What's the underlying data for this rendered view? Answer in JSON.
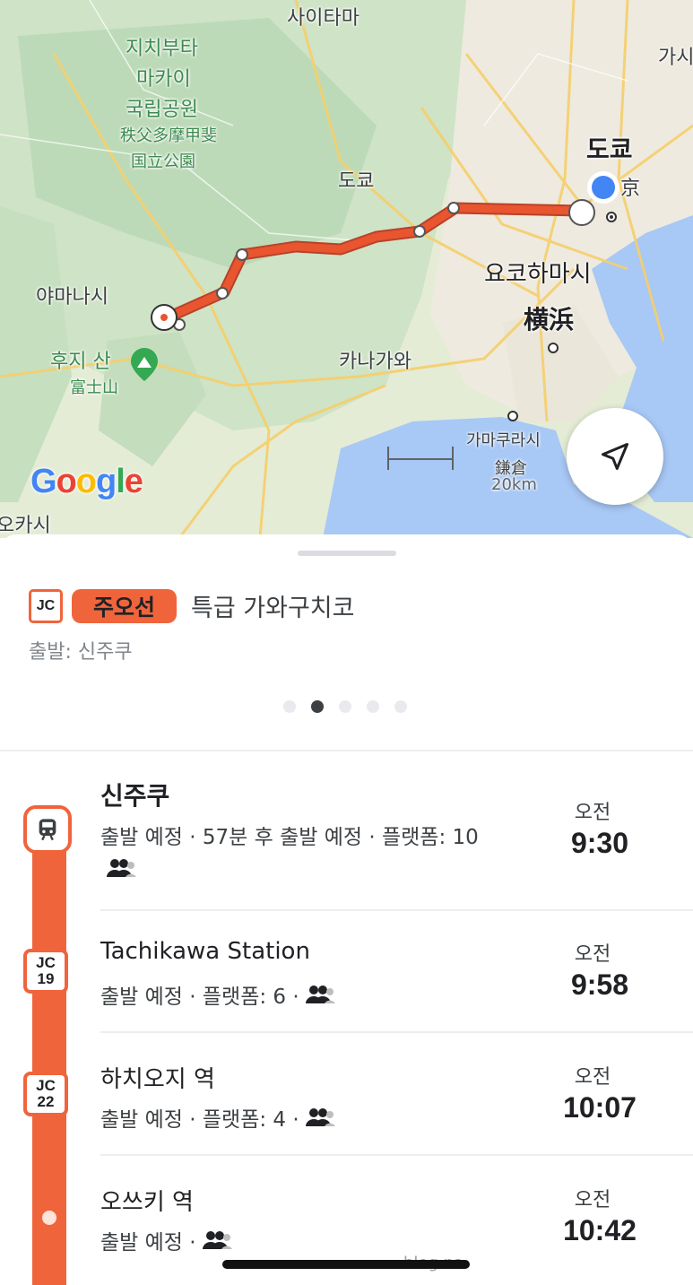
{
  "map": {
    "labels": {
      "saitama": "사이타마",
      "chichibu1": "지치부타",
      "chichibu2": "마카이",
      "chichibu3": "국립공원",
      "chichibu_jp1": "秩父多摩甲斐",
      "chichibu_jp2": "国立公園",
      "tokyo_pref": "도쿄",
      "tokyo_city": "도쿄",
      "tokyo_jp_fragment": "京",
      "kasi": "가시",
      "yamanashi": "야마나시",
      "fuji": "후지 산",
      "fuji_jp": "富士山",
      "yokohama": "요코하마시",
      "yokohama_jp": "横浜",
      "kanagawa": "카나가와",
      "kamakura": "가마쿠라시",
      "kamakura_jp": "鎌倉",
      "scale": "20km",
      "osaka_fragment": "오카시"
    },
    "google_logo": "Google",
    "locate_icon": "navigation-arrow-icon",
    "route_color": "#e8552f"
  },
  "route": {
    "line_badge": "JC",
    "line_name": "주오선",
    "train_name": "특급 가와구치코",
    "departure": "출발: 신주쿠",
    "page_count": 5,
    "active_page": 2
  },
  "stops": [
    {
      "name": "신주쿠",
      "detail": "출발 예정 · 57분 후 출발 예정 · 플랫폼: 10",
      "ampm": "오전",
      "time": "9:30",
      "badge": ""
    },
    {
      "name": "Tachikawa Station",
      "detail": "출발 예정 · 플랫폼: 6 · ",
      "ampm": "오전",
      "time": "9:58",
      "badge_line": "JC",
      "badge_num": "19"
    },
    {
      "name": "하치오지 역",
      "detail": "출발 예정 · 플랫폼: 4 · ",
      "ampm": "오전",
      "time": "10:07",
      "badge_line": "JC",
      "badge_num": "22"
    },
    {
      "name": "오쓰키 역",
      "detail": "출발 예정 · ",
      "ampm": "오전",
      "time": "10:42",
      "badge": ""
    }
  ],
  "accent": "#f0643c",
  "watermark": "blog.na"
}
